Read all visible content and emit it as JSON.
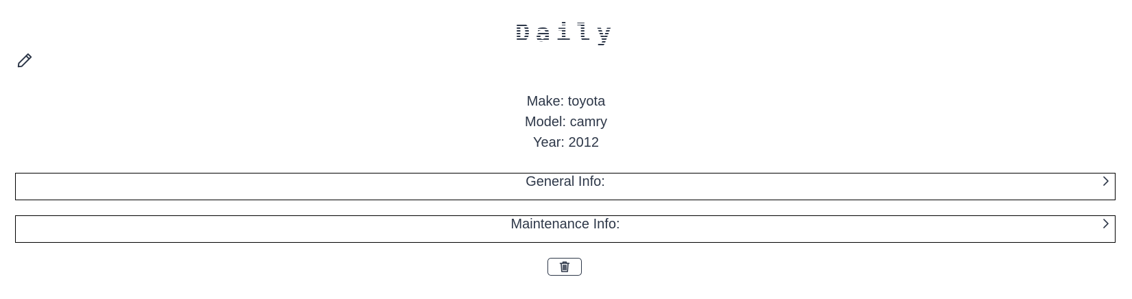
{
  "header": {
    "title": "Daily"
  },
  "vehicle": {
    "make": "Make: toyota",
    "model": "Model: camry",
    "year": "Year: 2012"
  },
  "sections": {
    "general_label": "General Info:",
    "maintenance_label": "Maintenance Info:"
  },
  "icons": {
    "edit": "pencil-icon",
    "expand": "chevron-right-icon",
    "delete": "trash-icon"
  },
  "colors": {
    "text": "#2d3748",
    "border": "#000000"
  }
}
